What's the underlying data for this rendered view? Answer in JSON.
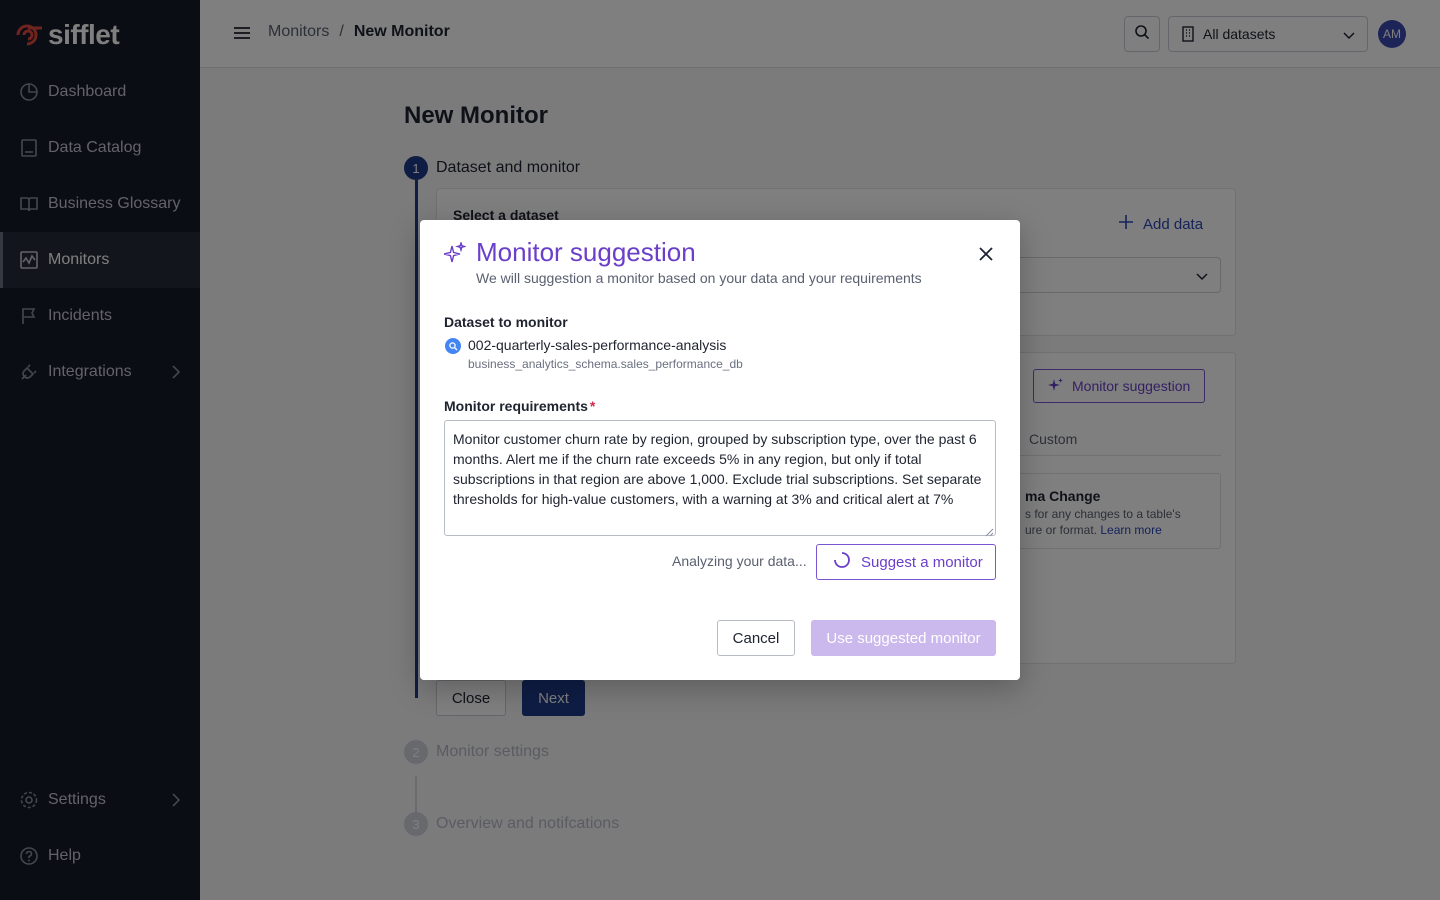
{
  "brand": {
    "name": "sifflet",
    "accent": "#6a3fc9",
    "primary": "#1e3a8a"
  },
  "sidebar": {
    "items": [
      {
        "label": "Dashboard",
        "icon": "dashboard-icon"
      },
      {
        "label": "Data Catalog",
        "icon": "book-icon"
      },
      {
        "label": "Business Glossary",
        "icon": "open-book-icon"
      },
      {
        "label": "Monitors",
        "icon": "chart-line-icon",
        "active": true
      },
      {
        "label": "Incidents",
        "icon": "flag-icon"
      },
      {
        "label": "Integrations",
        "icon": "plug-icon",
        "expandable": true
      }
    ],
    "bottom": [
      {
        "label": "Settings",
        "icon": "gear-icon",
        "expandable": true
      },
      {
        "label": "Help",
        "icon": "help-icon"
      }
    ]
  },
  "topbar": {
    "breadcrumb": {
      "parent": "Monitors",
      "separator": "/",
      "current": "New Monitor"
    },
    "dataset_filter": "All datasets",
    "avatar_initials": "AM"
  },
  "page": {
    "title": "New Monitor",
    "steps": [
      {
        "number": "1",
        "label": "Dataset and monitor"
      },
      {
        "number": "2",
        "label": "Monitor settings"
      },
      {
        "number": "3",
        "label": "Overview and notifcations"
      }
    ],
    "select_dataset_label": "Select a dataset",
    "add_data": "Add data",
    "monitor_suggestion_button": "Monitor suggestion",
    "tab_custom": "Custom",
    "schema_card": {
      "title": "ma Change",
      "desc_line1": "s for any changes to a table's",
      "desc_line2": "ure or format.",
      "learn_more": "Learn more"
    },
    "close_button": "Close",
    "next_button": "Next"
  },
  "modal": {
    "title": "Monitor suggestion",
    "subtitle": "We will suggestion a monitor based on your data and your requirements",
    "dataset_label": "Dataset to monitor",
    "dataset_name": "002-quarterly-sales-performance-analysis",
    "dataset_path": "business_analytics_schema.sales_performance_db",
    "requirements_label": "Monitor requirements",
    "required_mark": "*",
    "requirements_text": "Monitor customer churn rate by region, grouped by subscription type, over the past 6 months. Alert me if the churn rate exceeds 5% in any region, but only if total subscriptions in that region are above 1,000. Exclude trial subscriptions. Set separate thresholds for high-value customers, with a warning at 3% and critical alert at 7%",
    "status_text": "Analyzing your data...",
    "suggest_button": "Suggest a monitor",
    "cancel_button": "Cancel",
    "use_button": "Use suggested monitor"
  }
}
